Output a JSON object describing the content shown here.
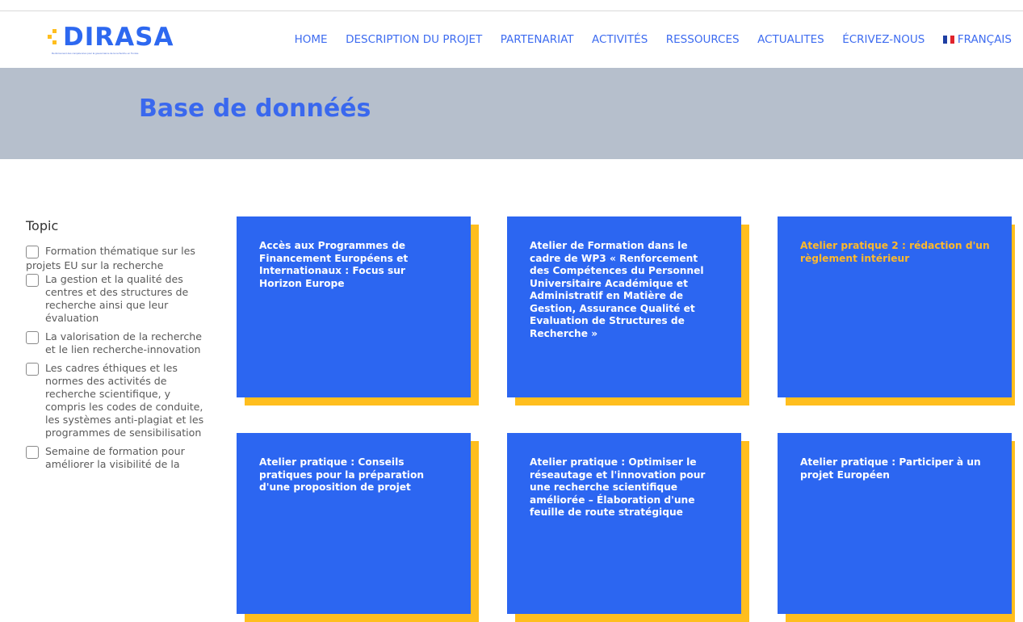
{
  "brand": {
    "name": "DIRASA",
    "tagline": "Renforcement des compétences pour la gouvernance de la recherche en Tunisie",
    "accent_color": "#2d68f0",
    "secondary_color": "#ffbe1e"
  },
  "nav": {
    "items": [
      "HOME",
      "DESCRIPTION DU PROJET",
      "PARTENARIAT",
      "ACTIVITÉS",
      "RESSOURCES",
      "ACTUALITES",
      "ÉCRIVEZ-NOUS"
    ],
    "language": "FRANÇAIS",
    "language_icon": "french-flag-icon"
  },
  "banner": {
    "title": "Base de donnéés",
    "background": "#b6bfcc"
  },
  "sidebar": {
    "heading": "Topic",
    "filters": [
      {
        "label": "Formation thématique sur les projets EU sur la recherche",
        "checked": false
      },
      {
        "label": "La gestion et la qualité des centres et des structures de recherche ainsi que leur évaluation",
        "checked": false
      },
      {
        "label": "La valorisation de la recherche et le lien recherche-innovation",
        "checked": false
      },
      {
        "label": "Les cadres éthiques et les normes des activités de recherche scientifique, y compris les codes de conduite, les systèmes anti-plagiat et les programmes de sensibilisation",
        "checked": false
      },
      {
        "label": "Semaine de formation pour améliorer la visibilité de la",
        "checked": false
      }
    ]
  },
  "cards": [
    {
      "title": "Accès aux Programmes de Financement Européens et Internationaux : Focus sur Horizon Europe",
      "hovered": false
    },
    {
      "title": "Atelier de Formation dans le cadre de WP3 « Renforcement des Compétences du Personnel Universitaire Académique et Administratif en Matière de Gestion, Assurance Qualité et Evaluation de Structures de Recherche »",
      "hovered": false
    },
    {
      "title": "Atelier pratique 2 : rédaction d'un règlement intérieur",
      "hovered": true
    },
    {
      "title": "Atelier pratique : Conseils pratiques pour la préparation d'une proposition de projet",
      "hovered": false
    },
    {
      "title": "Atelier pratique : Optimiser le réseautage et l'innovation pour une recherche scientifique améliorée – Élaboration d'une feuille de route stratégique",
      "hovered": false
    },
    {
      "title": "Atelier pratique : Participer à un projet Européen",
      "hovered": false
    }
  ]
}
